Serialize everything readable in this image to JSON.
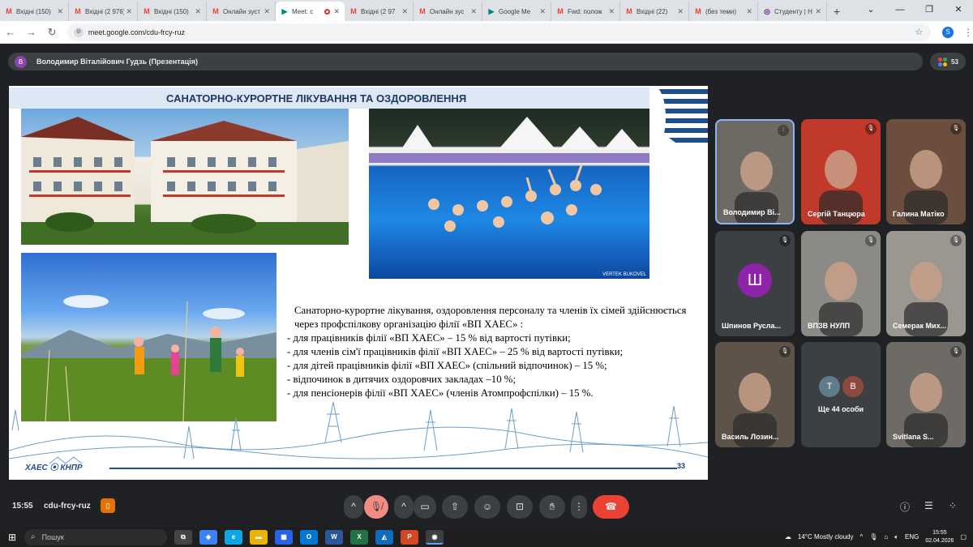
{
  "browser": {
    "tabs": [
      {
        "label": "Вхідні (150)",
        "icon": "gmail-icon",
        "active": false
      },
      {
        "label": "Вхідні (2 976)",
        "icon": "gmail-icon",
        "active": false
      },
      {
        "label": "Вхідні (150)",
        "icon": "gmail-icon",
        "active": false
      },
      {
        "label": "Онлайн зуст",
        "icon": "gmail-icon",
        "active": false
      },
      {
        "label": "Meet: c",
        "icon": "meet-icon",
        "active": true
      },
      {
        "label": "Вхідні (2 97",
        "icon": "gmail-icon",
        "active": false
      },
      {
        "label": "Онлайн зус",
        "icon": "gmail-icon",
        "active": false
      },
      {
        "label": "Google Me",
        "icon": "meet-icon",
        "active": false
      },
      {
        "label": "Fwd: полож",
        "icon": "gmail-icon",
        "active": false
      },
      {
        "label": "Вхідні (22)",
        "icon": "gmail-icon",
        "active": false
      },
      {
        "label": "(без теми)",
        "icon": "gmail-icon",
        "active": false
      },
      {
        "label": "Студенту | Н",
        "icon": "web-icon",
        "active": false
      }
    ],
    "new_tab": "+",
    "url": "meet.google.com/cdu-frcy-ruz",
    "profile_initial": "S"
  },
  "meet": {
    "presenter": {
      "initial": "В",
      "name": "Володимир Віталійович Гудзь (Презентація)"
    },
    "participants_count": "53",
    "meeting_time": "15:55",
    "meeting_code": "cdu-frcy-ruz",
    "participants": [
      {
        "name": "Володимир Ві...",
        "mic": "speaking",
        "bg": "#6d6a64"
      },
      {
        "name": "Сергій Танцюра",
        "mic": "muted",
        "bg": "#c0392b"
      },
      {
        "name": "Галина Матіко",
        "mic": "muted",
        "bg": "#6b4e3d"
      },
      {
        "name": "Шпинов Русла...",
        "mic": "muted",
        "bg": "#3c4043",
        "initial": "Ш"
      },
      {
        "name": "ВПЗВ НУЛП",
        "mic": "muted",
        "bg": "#8c8a86"
      },
      {
        "name": "Семерак Мих...",
        "mic": "muted",
        "bg": "#9a9690"
      },
      {
        "name": "Василь Лозин...",
        "mic": "muted",
        "bg": "#5d5348"
      },
      {
        "name": "",
        "mic": "none",
        "bg": "#3c4043",
        "more_initials": [
          "Т",
          "В"
        ],
        "more_label": "Ще 44 особи"
      },
      {
        "name": "Svitlana S...",
        "mic": "muted",
        "bg": "#6e6a66"
      }
    ]
  },
  "slide": {
    "title": "САНАТОРНО-КУРОРТНЕ ЛІКУВАННЯ ТА ОЗДОРОВЛЕННЯ",
    "photo_credit": "VERTEK BUKOVEL",
    "intro": "Санаторно-курортне лікування, оздоровлення персоналу та членів їх сімей здійснюється через профспілкову організацію філії «ВП ХАЕС» :",
    "items": [
      "- для працівників філії «ВП ХАЕС» – 15 % від вартості путівки;",
      "- для членів сім'ї працівників філії «ВП ХАЕС» – 25 % від вартості путівки;",
      "- для дітей працівників філії «ВП ХАЕС» (спільний відпочинок) – 15 %;",
      "- відпочинок в дитячих оздоровчих закладах –10 %;",
      "- для пенсіонерів філії «ВП ХАЕС» (членів Атомпрофспілки) – 15 %."
    ],
    "footer_logo": "ХАЕС ⦿ КНПР",
    "page_number": "33"
  },
  "taskbar": {
    "search_placeholder": "Пошук",
    "weather": "14°C  Mostly cloudy",
    "language": "ENG",
    "time": "15:55",
    "date": "02.04.2026"
  },
  "colors": {
    "meet_bg": "#202124",
    "hangup": "#ea4335",
    "slide_title": "#1f3864"
  }
}
